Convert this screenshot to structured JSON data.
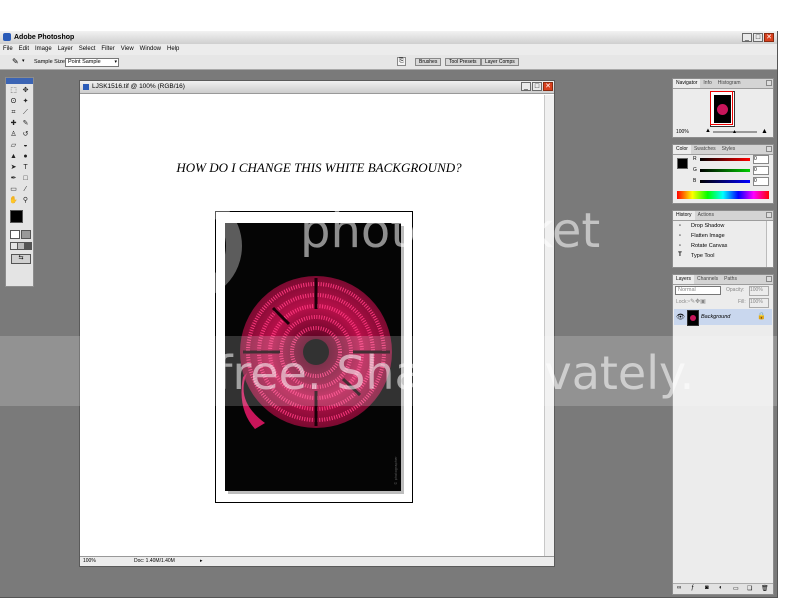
{
  "app": {
    "title": "Adobe Photoshop",
    "controls": [
      "_",
      "□",
      "✕"
    ]
  },
  "menu": [
    "File",
    "Edit",
    "Image",
    "Layer",
    "Select",
    "Filter",
    "View",
    "Window",
    "Help"
  ],
  "options": {
    "sample_size_label": "Sample Size:",
    "sample_size_value": "Point Sample",
    "palette_wells": [
      "Brushes",
      "Tool Presets",
      "Layer Comps"
    ]
  },
  "document": {
    "title": "LJSK1516.tif @ 100% (RGB/16)",
    "canvas_text": "HOW  DO I CHANGE THIS WHITE BACKGROUND?",
    "zoom": "100%",
    "doc_info": "Doc: 1.40M/1.40M"
  },
  "navigator": {
    "tabs": [
      "Navigator",
      "Info",
      "Histogram"
    ],
    "zoom": "100%"
  },
  "color": {
    "tabs": [
      "Color",
      "Swatches",
      "Styles"
    ],
    "channels": [
      {
        "label": "R",
        "value": "0"
      },
      {
        "label": "G",
        "value": "0"
      },
      {
        "label": "B",
        "value": "0"
      }
    ]
  },
  "history": {
    "tabs": [
      "History",
      "Actions"
    ],
    "items": [
      "Drop Shadow",
      "Flatten Image",
      "Rotate Canvas",
      "Type Tool"
    ]
  },
  "layers": {
    "tabs": [
      "Layers",
      "Channels",
      "Paths"
    ],
    "blend_mode": "Normal",
    "opacity_label": "Opacity:",
    "opacity": "100%",
    "lock_label": "Lock:",
    "fill_label": "Fill:",
    "fill": "100%",
    "layer_name": "Background"
  },
  "watermark": {
    "brand": "photobucket",
    "tagline": "Join free. Share privately."
  },
  "colors": {
    "accent": "#e2245f",
    "workspace": "#7a7a7a"
  }
}
